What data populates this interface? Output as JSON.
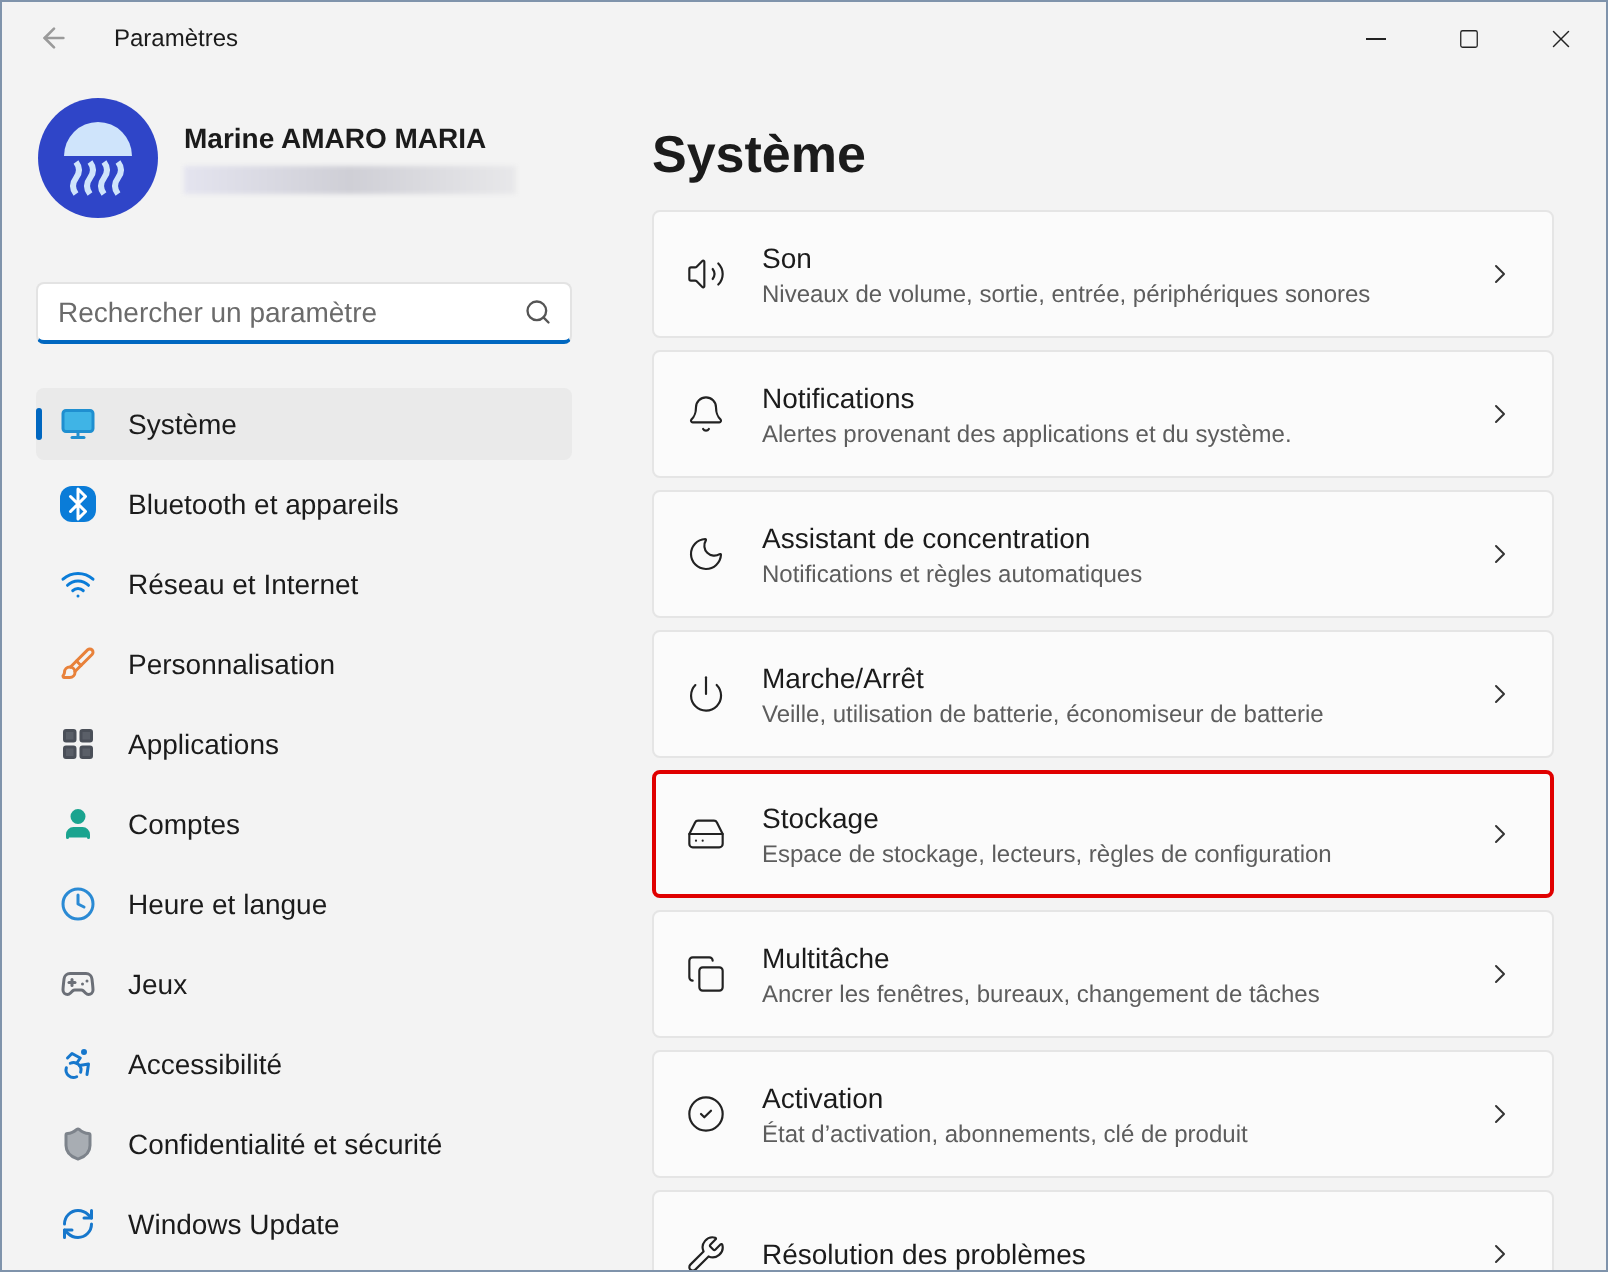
{
  "window": {
    "title": "Paramètres"
  },
  "profile": {
    "name": "Marine AMARO MARIA"
  },
  "search": {
    "placeholder": "Rechercher un paramètre"
  },
  "sidebar": {
    "items": [
      {
        "label": "Système",
        "selected": true
      },
      {
        "label": "Bluetooth et appareils",
        "selected": false
      },
      {
        "label": "Réseau et Internet",
        "selected": false
      },
      {
        "label": "Personnalisation",
        "selected": false
      },
      {
        "label": "Applications",
        "selected": false
      },
      {
        "label": "Comptes",
        "selected": false
      },
      {
        "label": "Heure et langue",
        "selected": false
      },
      {
        "label": "Jeux",
        "selected": false
      },
      {
        "label": "Accessibilité",
        "selected": false
      },
      {
        "label": "Confidentialité et sécurité",
        "selected": false
      },
      {
        "label": "Windows Update",
        "selected": false
      }
    ]
  },
  "page": {
    "heading": "Système",
    "cards": [
      {
        "title": "Son",
        "subtitle": "Niveaux de volume, sortie, entrée, périphériques sonores",
        "highlighted": false
      },
      {
        "title": "Notifications",
        "subtitle": "Alertes provenant des applications et du système.",
        "highlighted": false
      },
      {
        "title": "Assistant de concentration",
        "subtitle": "Notifications et règles automatiques",
        "highlighted": false
      },
      {
        "title": "Marche/Arrêt",
        "subtitle": "Veille, utilisation de batterie, économiseur de batterie",
        "highlighted": false
      },
      {
        "title": "Stockage",
        "subtitle": "Espace de stockage, lecteurs, règles de configuration",
        "highlighted": true
      },
      {
        "title": "Multitâche",
        "subtitle": "Ancrer les fenêtres, bureaux, changement de tâches",
        "highlighted": false
      },
      {
        "title": "Activation",
        "subtitle": "État d’activation, abonnements, clé de produit",
        "highlighted": false
      },
      {
        "title": "Résolution des problèmes",
        "highlighted": false
      }
    ]
  }
}
